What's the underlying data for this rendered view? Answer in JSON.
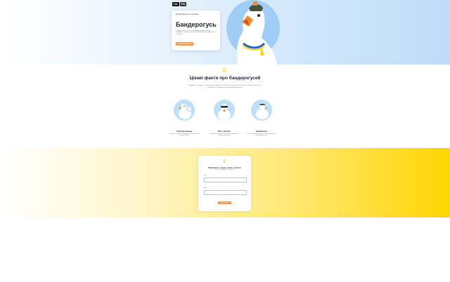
{
  "hero": {
    "lang": [
      "UA",
      "EN"
    ],
    "eyebrow": "Добрий вечір, ми з України",
    "title": "Бандерогусь",
    "text": "Легендарний птах, який став символом опору. Стрімкий, хоробрий і завжди на варті. Дізнайся більше про бандерогусів та їхні звички.",
    "button": "Дізнатися більше"
  },
  "facts": {
    "title": "Цікаві факти про бандерогусей",
    "intro": "Бандерогусь — створіння, яке не потребує представлення. Він вражає своєю силою, кмітливістю та незламною волею. Ось кілька фактів, які допоможуть краще зрозуміти цього птаха.",
    "items": [
      {
        "title": "Світове явище",
        "desc": "Бандерогусь став символом незламності, відомим далеко за межами України."
      },
      {
        "title": "Про тактику",
        "desc": "Бандерогусь відомий своєю стратегічною кмітливістю та несподіваними атаками."
      },
      {
        "title": "Байрактар",
        "desc": "Кажуть, що бандерогусь дружить з Байрактаром і разом вони охороняють небо."
      }
    ]
  },
  "form": {
    "title": "Підпишись, будь ласка, хлопче",
    "subtitle": "і отримай нові факти про бандерогусей",
    "name_label": "Ім'я",
    "name_placeholder": "",
    "email_label": "Email",
    "email_placeholder": "",
    "submit": "Підписатися"
  },
  "colors": {
    "accent": "#f39a4c",
    "sky": "#bfdcf8",
    "yellow": "#ffd500"
  }
}
